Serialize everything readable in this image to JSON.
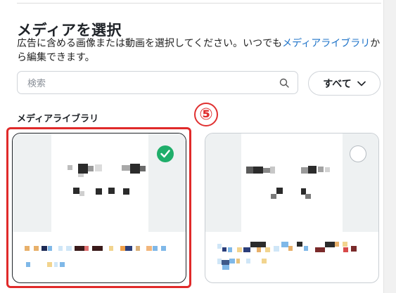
{
  "panel": {
    "title": "メディアを選択",
    "description_text": "広告に含める画像または動画を選択してください。いつでも",
    "description_link": "メディアライブラリ",
    "description_suffix": "から編集できます。"
  },
  "search": {
    "placeholder": "検索",
    "value": ""
  },
  "filter": {
    "label": "すべて"
  },
  "section": {
    "label": "メディアライブラリ"
  },
  "annotation": {
    "step_number": "⑤",
    "highlight_color": "#e02a2a"
  },
  "media_items": [
    {
      "selected": true,
      "selection_color": "#1fae6a"
    },
    {
      "selected": false
    }
  ],
  "colors": {
    "accent_link": "#1e73c8",
    "selected_check": "#1fae6a",
    "annotation_red": "#e03030"
  }
}
